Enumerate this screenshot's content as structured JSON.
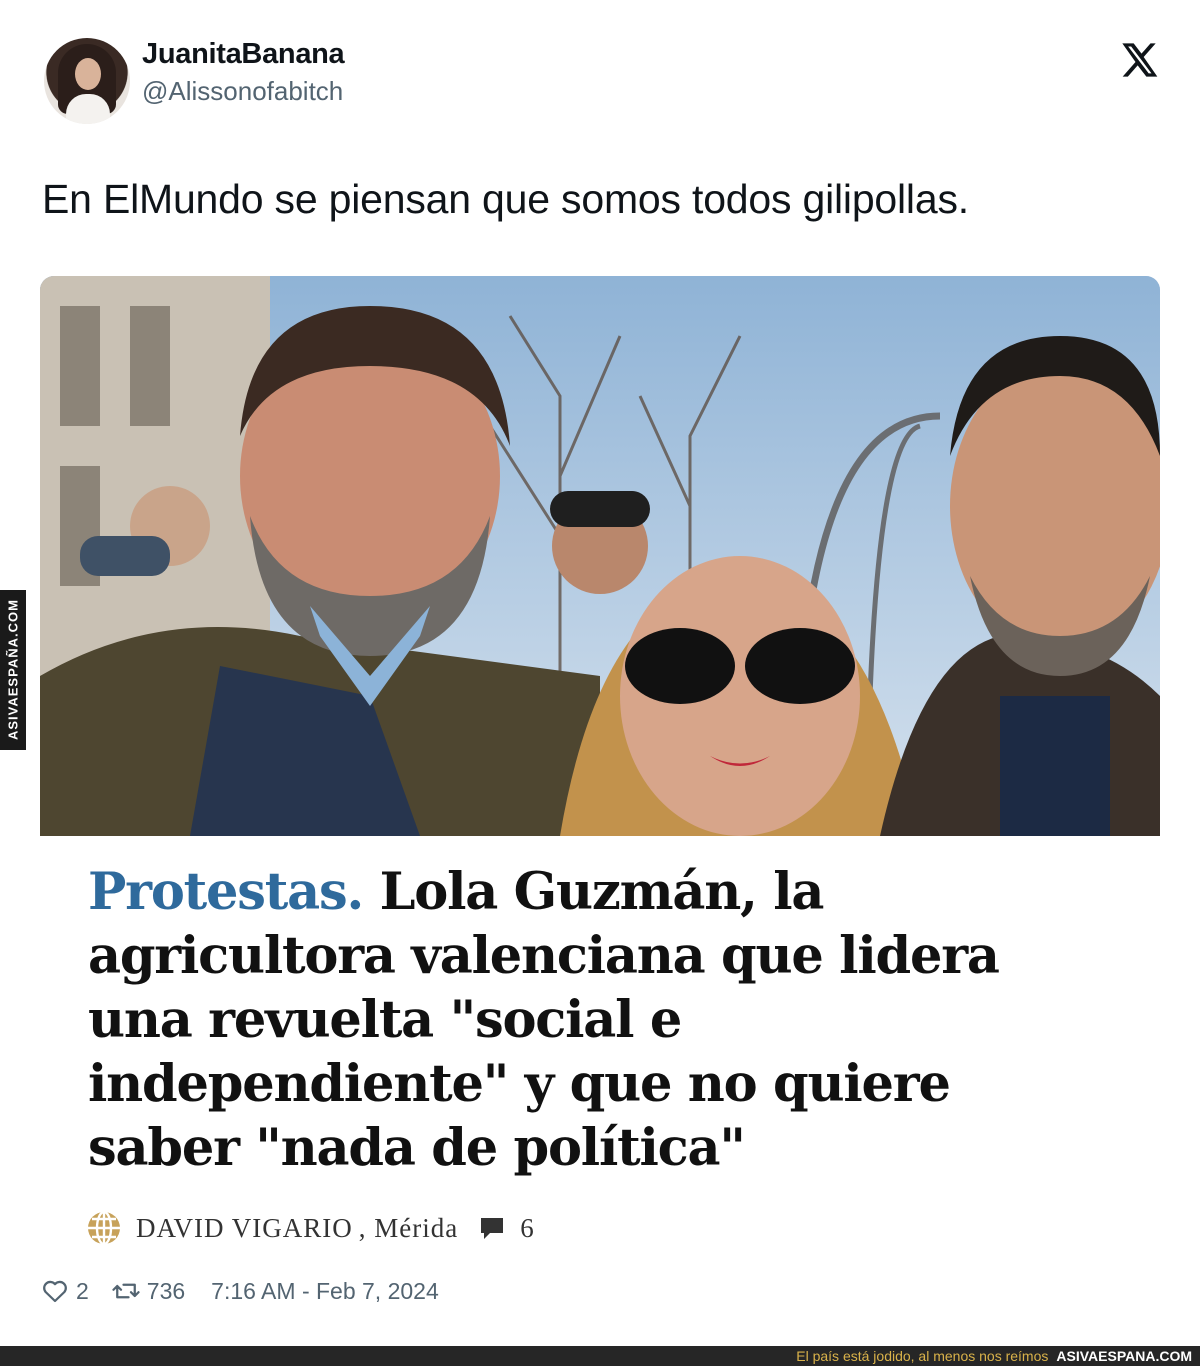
{
  "author": {
    "display_name": "JuanitaBanana",
    "handle": "@Alissonofabitch",
    "avatar_icon": "avatar"
  },
  "platform_icon": "x-logo-icon",
  "tweet": {
    "text": "En ElMundo se piensan que somos todos gilipollas."
  },
  "article": {
    "kicker": "Protestas.",
    "headline": " Lola Guzmán, la agricultora valenciana que lidera una revuelta \"social e independiente\" y que no quiere saber \"nada de política\"",
    "byline_author": "DAVID VIGARIO",
    "byline_location": ", Mérida",
    "comment_count": "6",
    "outlet_icon": "globe-icon",
    "comment_icon": "comment-icon",
    "kicker_color": "#2f6a9c"
  },
  "engagement": {
    "likes": "2",
    "retweets": "736",
    "timestamp": "7:16 AM - Feb 7, 2024"
  },
  "watermark": {
    "side_text": "ASIVAESPAÑA.COM",
    "footer_slogan": "El país está jodido, al menos nos reímos",
    "footer_site": "ASIVAESPANA.COM"
  }
}
